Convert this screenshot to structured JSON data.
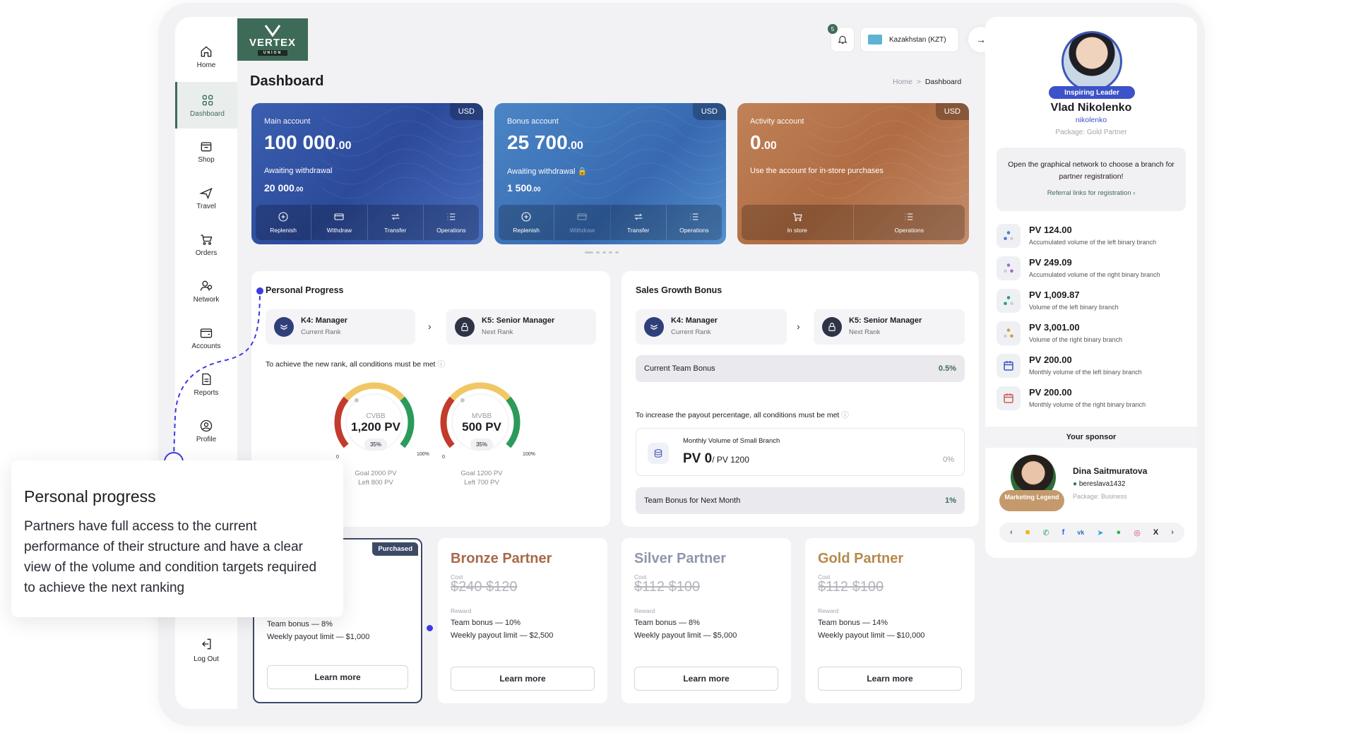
{
  "nav": {
    "home": "Home",
    "dashboard": "Dashboard",
    "shop": "Shop",
    "travel": "Travel",
    "orders": "Orders",
    "network": "Network",
    "accounts": "Accounts",
    "reports": "Reports",
    "profile": "Profile",
    "logout": "Log Out"
  },
  "brand": {
    "name": "VERTEX",
    "sub": "UNION"
  },
  "topbar": {
    "notifications": "5",
    "country": "Kazakhstan (KZT)"
  },
  "header": {
    "title": "Dashboard",
    "crumb_home": "Home",
    "crumb_sep": ">",
    "crumb_current": "Dashboard"
  },
  "accounts": {
    "main": {
      "label": "Main account",
      "currency": "USD",
      "amount": "100 000",
      "cents": ".00",
      "awaiting_label": "Awaiting withdrawal",
      "awaiting": "20 000",
      "awaiting_cents": ".00",
      "ops": [
        "Replenish",
        "Withdraw",
        "Transfer",
        "Operations"
      ]
    },
    "bonus": {
      "label": "Bonus account",
      "currency": "USD",
      "amount": "25 700",
      "cents": ".00",
      "awaiting_label": "Awaiting withdrawal",
      "awaiting": "1 500",
      "awaiting_cents": ".00",
      "ops": [
        "Replenish",
        "Withdraw",
        "Transfer",
        "Operations"
      ]
    },
    "activity": {
      "label": "Activity account",
      "currency": "USD",
      "amount": "0",
      "cents": ".00",
      "note": "Use the account for in-store purchases",
      "ops": [
        "In store",
        "Operations"
      ]
    }
  },
  "progress": {
    "title": "Personal Progress",
    "current_rank": "K4: Manager",
    "current_label": "Current Rank",
    "next_rank": "K5: Senior Manager",
    "next_label": "Next Rank",
    "note": "To achieve the new rank, all conditions must be met",
    "gauges": [
      {
        "label": "CVBB",
        "value": "1,200 PV",
        "pct": "35%",
        "fraction": 0.35,
        "min": "0",
        "max": "100%",
        "goal": "Goal 2000 PV",
        "left": "Left 800 PV"
      },
      {
        "label": "MVBB",
        "value": "500 PV",
        "pct": "35%",
        "fraction": 0.35,
        "min": "0",
        "max": "100%",
        "goal": "Goal 1200 PV",
        "left": "Left 700 PV"
      }
    ]
  },
  "sales": {
    "title": "Sales Growth Bonus",
    "current_rank": "K4: Manager",
    "current_label": "Current Rank",
    "next_rank": "K5: Senior Manager",
    "next_label": "Next Rank",
    "current_bonus_label": "Current Team Bonus",
    "current_bonus": "0.5%",
    "note": "To increase the payout percentage, all conditions must be met",
    "mv_label": "Monthly Volume of Small Branch",
    "mv_value": "PV 0",
    "mv_target": "/ PV 1200",
    "mv_pct": "0%",
    "next_bonus_label": "Team Bonus for Next Month",
    "next_bonus": "1%"
  },
  "packages": [
    {
      "name": "",
      "badge": "Purchased",
      "bonus": "Team bonus — 8%",
      "limit": "Weekly payout limit — $1,000",
      "cta": "Learn more"
    },
    {
      "name": "Bronze Partner",
      "cost_label": "Cost",
      "old_price": "$240",
      "price": "$120",
      "reward_label": "Reward",
      "bonus": "Team bonus — 10%",
      "limit": "Weekly payout limit — $2,500",
      "cta": "Learn more",
      "color": "#a8694a"
    },
    {
      "name": "Silver Partner",
      "cost_label": "Cost",
      "old_price": "$112",
      "price": "$100",
      "reward_label": "Reward",
      "bonus": "Team bonus — 8%",
      "limit": "Weekly payout limit — $5,000",
      "cta": "Learn more",
      "color": "#8e97aa"
    },
    {
      "name": "Gold Partner",
      "cost_label": "Cost",
      "old_price": "$112",
      "price": "$100",
      "reward_label": "Reward",
      "bonus": "Team bonus — 14%",
      "limit": "Weekly payout limit — $10,000",
      "cta": "Learn more",
      "color": "#b58a4c"
    }
  ],
  "profile": {
    "tag": "Inspiring Leader",
    "name": "Vlad Nikolenko",
    "username": "nikolenko",
    "package": "Package: Gold Partner",
    "cta_text": "Open the graphical network to choose a branch for partner registration!",
    "cta_link": "Referral links for registration",
    "stats": [
      {
        "value": "PV 124.00",
        "label": "Accumulated volume of the left binary branch"
      },
      {
        "value": "PV 249.09",
        "label": "Accumulated volume of the right binary branch"
      },
      {
        "value": "PV 1,009.87",
        "label": "Volume of the left binary branch"
      },
      {
        "value": "PV 3,001.00",
        "label": "Volume of the right binary branch"
      },
      {
        "value": "PV 200.00",
        "label": "Monthly volume of the left binary branch"
      },
      {
        "value": "PV 200.00",
        "label": "Monthly volume of the right binary branch"
      }
    ],
    "sponsor_title": "Your sponsor",
    "sponsor": {
      "tag": "Marketing Legend",
      "name": "Dina Saitmuratova",
      "username": "bereslava1432",
      "package": "Package: Business"
    }
  },
  "tooltip": {
    "title": "Personal progress",
    "body": "Partners have full access to the current performance of their structure and have a clear view of the volume and condition targets required to achieve the next ranking"
  },
  "colors": {
    "brand": "#3e6b57",
    "leader": "#3b52c8",
    "gauge_red": "#c23b2c",
    "gauge_yellow": "#f1c766",
    "gauge_green": "#2c9a5a",
    "guide": "#3d3ae0"
  }
}
